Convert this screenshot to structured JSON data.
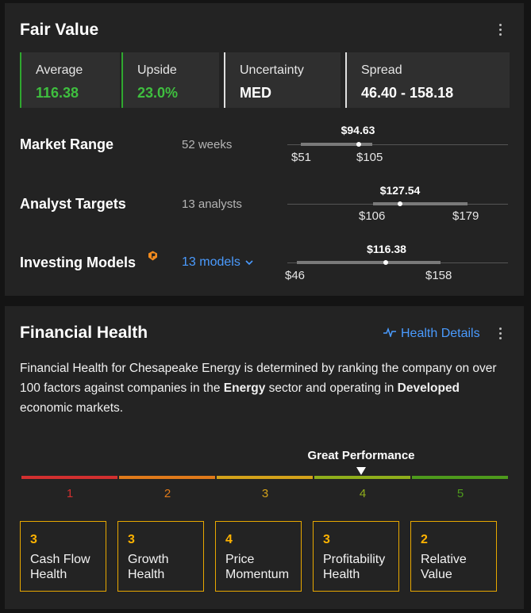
{
  "fair_value": {
    "title": "Fair Value",
    "menu_icon": "kebab-menu-icon",
    "stats": [
      {
        "label": "Average",
        "value": "116.38",
        "color": "#3fbf3f"
      },
      {
        "label": "Upside",
        "value": "23.0%",
        "color": "#3fbf3f"
      },
      {
        "label": "Uncertainty",
        "value": "MED",
        "color": "#ffffff"
      },
      {
        "label": "Spread",
        "value": "46.40 - 158.18",
        "color": "#ffffff"
      }
    ],
    "market_range": {
      "label": "Market Range",
      "sub": "52 weeks",
      "current": "$94.63",
      "low": "$51",
      "high": "$105"
    },
    "analyst_targets": {
      "label": "Analyst Targets",
      "sub": "13 analysts",
      "current": "$127.54",
      "low": "$106",
      "high": "$179"
    },
    "investing_models": {
      "label": "Investing Models",
      "link": "13 models",
      "badge_icon": "pro-badge-icon",
      "current": "$116.38",
      "low": "$46",
      "high": "$158"
    }
  },
  "financial_health": {
    "title": "Financial Health",
    "details_link": "Health Details",
    "details_icon": "pulse-line-icon",
    "menu_icon": "kebab-menu-icon",
    "description": {
      "part1": "Financial Health for Chesapeake Energy is determined by ranking the company on over 100 factors against companies in the ",
      "sector": "Energy",
      "part2": " sector and operating in ",
      "market": "Developed",
      "part3": " economic markets."
    },
    "performance_label": "Great Performance",
    "performance_score": 4,
    "scale": [
      {
        "num": "1",
        "color": "#d23030"
      },
      {
        "num": "2",
        "color": "#e07a1a"
      },
      {
        "num": "3",
        "color": "#d4a21a"
      },
      {
        "num": "4",
        "color": "#8fae1b"
      },
      {
        "num": "5",
        "color": "#4e9a1c"
      }
    ],
    "categories": [
      {
        "score": "3",
        "line1": "Cash Flow",
        "line2": "Health"
      },
      {
        "score": "3",
        "line1": "Growth",
        "line2": "Health"
      },
      {
        "score": "4",
        "line1": "Price",
        "line2": "Momentum"
      },
      {
        "score": "3",
        "line1": "Profitability",
        "line2": "Health"
      },
      {
        "score": "2",
        "line1": "Relative",
        "line2": "Value"
      }
    ]
  }
}
